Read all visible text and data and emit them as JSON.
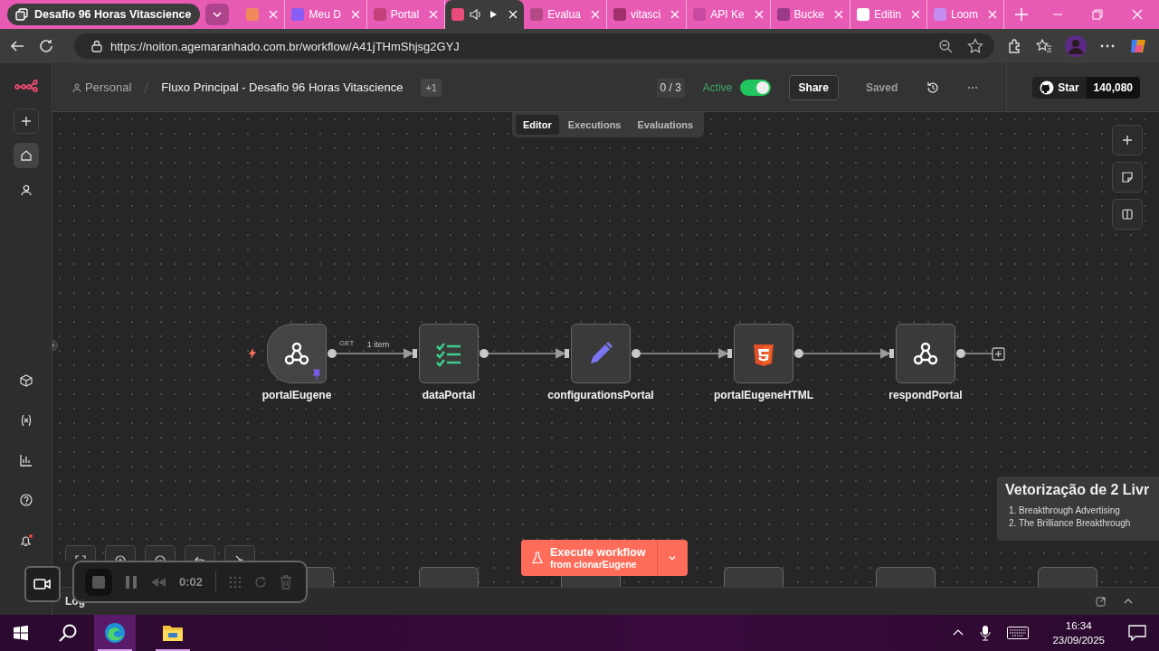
{
  "browser": {
    "tab_group": "Desafio 96 Horas Vitascience",
    "tabs": [
      {
        "selected": false,
        "color": "#f08a5d"
      },
      {
        "title": "Meu D",
        "selected": false,
        "color": "#8a5cf6"
      },
      {
        "title": "Portal",
        "selected": false,
        "color": "#c2417a"
      },
      {
        "selected": true,
        "audio": true,
        "color": "#e94b7a"
      },
      {
        "title": "Evalua",
        "selected": false,
        "color": "#b34a86"
      },
      {
        "title": "vitasci",
        "selected": false,
        "color": "#a0306c"
      },
      {
        "title": "API Ke",
        "selected": false,
        "color": "#c64aa0"
      },
      {
        "title": "Bucke",
        "selected": false,
        "color": "#9b3a86"
      },
      {
        "title": "Editin",
        "selected": false,
        "color": "#ffffff"
      },
      {
        "title": "Loom",
        "selected": false,
        "color": "#c58cf0"
      }
    ],
    "url": "https://noiton.agemaranhado.com.br/workflow/A41jTHmShjsg2GYJ"
  },
  "sidebar_nav": [
    {
      "selected": true
    },
    {
      "selected": false
    }
  ],
  "header": {
    "project": "Personal",
    "workflow_name": "Fluxo Principal - Desafio 96 Horas Vitascience",
    "tag_count": "+1",
    "tests": "0 / 3",
    "active_label": "Active",
    "active": true,
    "share": "Share",
    "saved": "Saved",
    "github_star": "Star",
    "star_count": "140,080"
  },
  "view_tabs": [
    {
      "label": "Editor",
      "selected": true
    },
    {
      "label": "Executions",
      "selected": false
    },
    {
      "label": "Evaluations",
      "selected": false
    }
  ],
  "nodes": [
    {
      "name": "portalEugene",
      "kind": "webhook",
      "trigger": true,
      "method": "GET",
      "pinned": true,
      "output_label": "1 item"
    },
    {
      "name": "dataPortal",
      "kind": "list",
      "trigger": false
    },
    {
      "name": "configurationsPortal",
      "kind": "edit",
      "trigger": false
    },
    {
      "name": "portalEugeneHTML",
      "kind": "html",
      "trigger": false
    },
    {
      "name": "respondPortal",
      "kind": "webhook",
      "trigger": false
    }
  ],
  "execute": {
    "label": "Execute workflow",
    "sublabel": "from clonarEugene"
  },
  "sticky_note": {
    "title": "Vetorização de 2 Livr",
    "items": [
      "1. Breakthrough Advertising",
      "2. The Brilliance Breakthrough"
    ]
  },
  "logs_label": "Log",
  "recorder": {
    "time": "0:02"
  },
  "taskbar": {
    "apps": [
      {
        "kind": "edge",
        "selected": true
      },
      {
        "kind": "explorer",
        "selected": false
      }
    ],
    "time": "16:34",
    "date": "23/09/2025"
  }
}
